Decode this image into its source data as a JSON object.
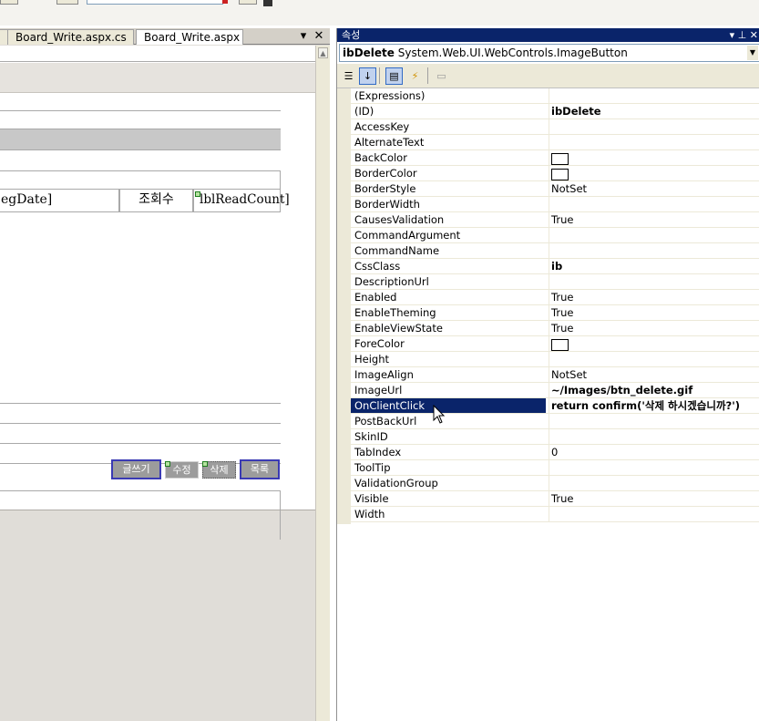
{
  "editor": {
    "tabs": [
      {
        "label": "Board_Write.aspx.cs"
      },
      {
        "label": "Board_Write.aspx"
      }
    ],
    "tab_menu_icon": "▾",
    "tab_close_icon": "✕",
    "form": {
      "regdate_label": "egDate]",
      "readcount_title": "조회수",
      "readcount_label": "lblReadCount]",
      "buttons": [
        {
          "label": "글쓰기"
        },
        {
          "label": "수정"
        },
        {
          "label": "삭제"
        },
        {
          "label": "목록"
        }
      ]
    }
  },
  "properties": {
    "title": "속성",
    "title_buttons": "▾ ⊥ ✕",
    "object_name": "ibDelete",
    "object_type": "System.Web.UI.WebControls.ImageButton",
    "rows": [
      {
        "name": "(Expressions)",
        "value": ""
      },
      {
        "name": "(ID)",
        "value": "ibDelete",
        "bold": true
      },
      {
        "name": "AccessKey",
        "value": ""
      },
      {
        "name": "AlternateText",
        "value": ""
      },
      {
        "name": "BackColor",
        "value": "",
        "swatch": true
      },
      {
        "name": "BorderColor",
        "value": "",
        "swatch": true
      },
      {
        "name": "BorderStyle",
        "value": "NotSet"
      },
      {
        "name": "BorderWidth",
        "value": ""
      },
      {
        "name": "CausesValidation",
        "value": "True"
      },
      {
        "name": "CommandArgument",
        "value": ""
      },
      {
        "name": "CommandName",
        "value": ""
      },
      {
        "name": "CssClass",
        "value": "ib",
        "bold": true
      },
      {
        "name": "DescriptionUrl",
        "value": ""
      },
      {
        "name": "Enabled",
        "value": "True"
      },
      {
        "name": "EnableTheming",
        "value": "True"
      },
      {
        "name": "EnableViewState",
        "value": "True"
      },
      {
        "name": "ForeColor",
        "value": "",
        "swatch": true
      },
      {
        "name": "Height",
        "value": ""
      },
      {
        "name": "ImageAlign",
        "value": "NotSet"
      },
      {
        "name": "ImageUrl",
        "value": "~/Images/btn_delete.gif",
        "bold": true
      },
      {
        "name": "OnClientClick",
        "value": "return confirm('삭제 하시겠습니까?')",
        "bold": true,
        "selected": true
      },
      {
        "name": "PostBackUrl",
        "value": ""
      },
      {
        "name": "SkinID",
        "value": ""
      },
      {
        "name": "TabIndex",
        "value": "0"
      },
      {
        "name": "ToolTip",
        "value": ""
      },
      {
        "name": "ValidationGroup",
        "value": ""
      },
      {
        "name": "Visible",
        "value": "True"
      },
      {
        "name": "Width",
        "value": ""
      }
    ]
  }
}
